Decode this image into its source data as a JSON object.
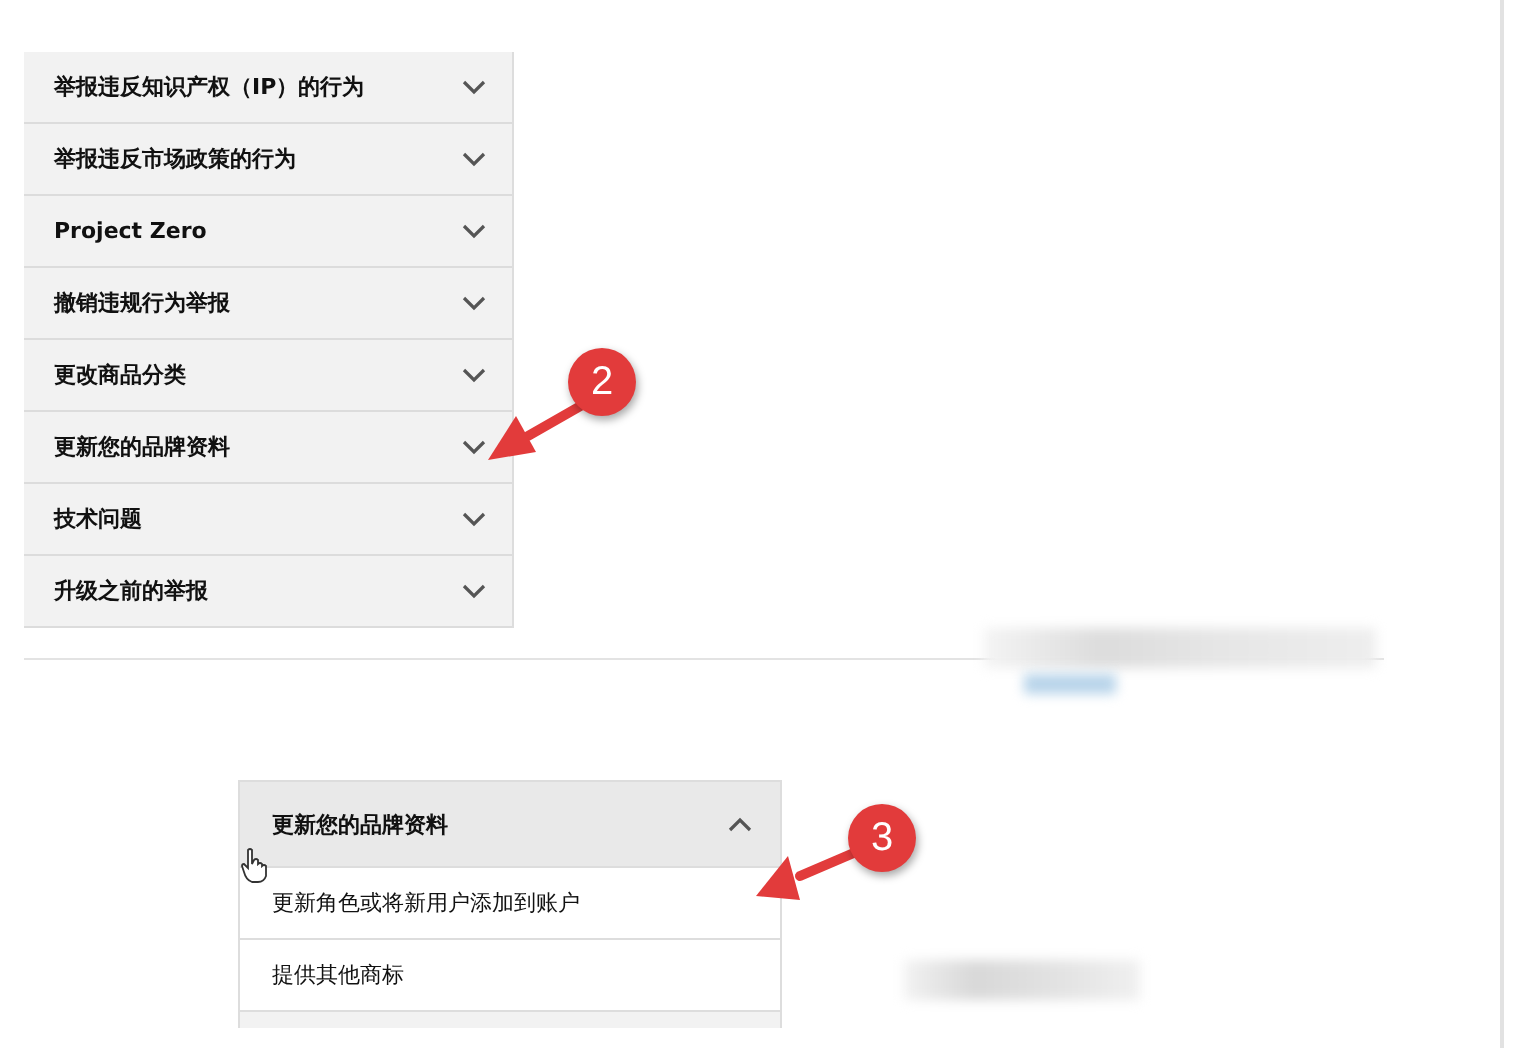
{
  "accordion": {
    "items": [
      {
        "label": "举报违反知识产权（IP）的行为",
        "expanded": false
      },
      {
        "label": "举报违反市场政策的行为",
        "expanded": false
      },
      {
        "label": "Project Zero",
        "expanded": false
      },
      {
        "label": "撤销违规行为举报",
        "expanded": false
      },
      {
        "label": "更改商品分类",
        "expanded": false
      },
      {
        "label": "更新您的品牌资料",
        "expanded": false
      },
      {
        "label": "技术问题",
        "expanded": false
      },
      {
        "label": "升级之前的举报",
        "expanded": false
      }
    ]
  },
  "expanded_accordion": {
    "header": {
      "label": "更新您的品牌资料",
      "expanded": true
    },
    "items": [
      "更新角色或将新用户添加到账户",
      "提供其他商标"
    ]
  },
  "annotations": [
    {
      "label": "2"
    },
    {
      "label": "3"
    }
  ]
}
